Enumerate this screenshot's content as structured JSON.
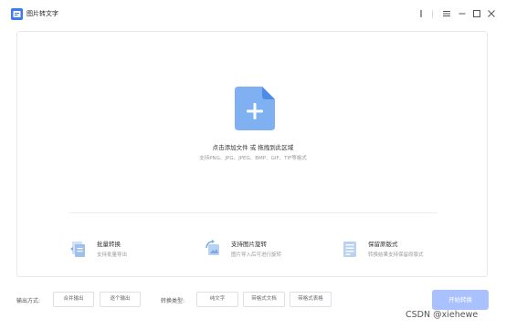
{
  "app": {
    "title": "图片转文字"
  },
  "dropzone": {
    "title": "点击添加文件 或 拖拽到此区域",
    "subtitle": "支持PNG、JPG、JPEG、BMP、GIF、TIF等格式"
  },
  "features": [
    {
      "title": "批量转换",
      "subtitle": "支持批量导出",
      "icon": "batch-convert-icon"
    },
    {
      "title": "支持图片旋转",
      "subtitle": "图片导入后可进行旋转",
      "icon": "rotate-image-icon"
    },
    {
      "title": "保留原版式",
      "subtitle": "转换结果支持保留原版式",
      "icon": "keep-layout-icon"
    }
  ],
  "bottom": {
    "output_label": "输出方式:",
    "output_options": [
      "合并输出",
      "逐个输出"
    ],
    "type_label": "转换类型:",
    "type_options": [
      "纯文字",
      "带格式文档",
      "带格式表格"
    ],
    "start_label": "开始转换"
  },
  "watermark": "CSDN @xiehewe",
  "colors": {
    "accent": "#5b8bf7",
    "start_button": "#a9c1ff",
    "file_icon": "#7fb0f2"
  }
}
